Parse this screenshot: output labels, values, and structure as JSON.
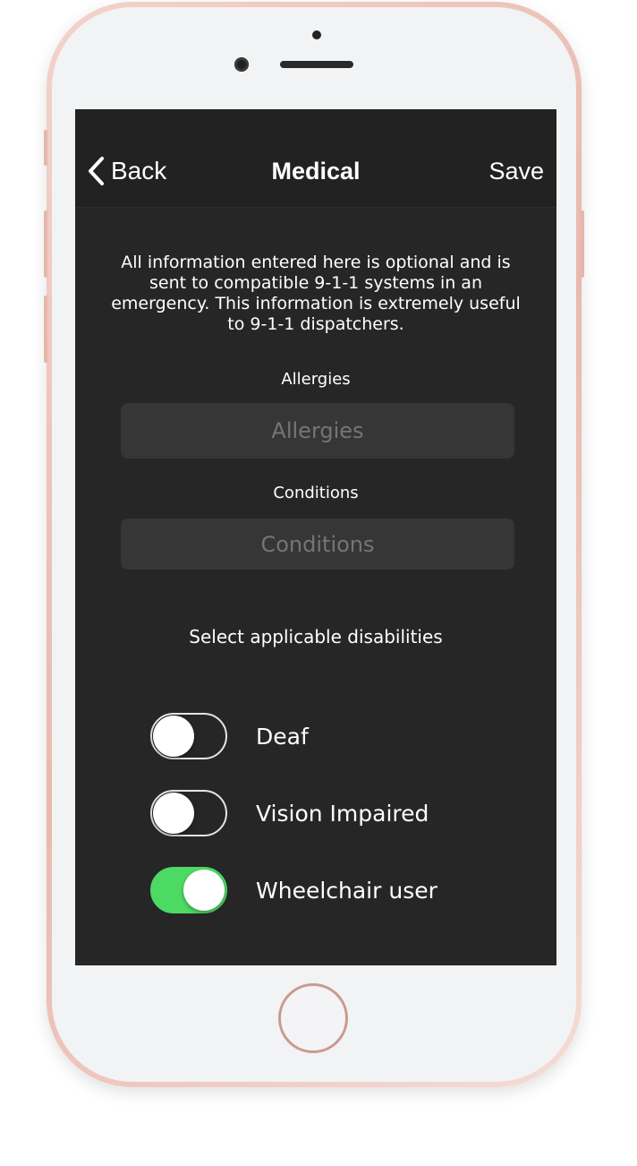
{
  "nav": {
    "back_label": "Back",
    "title": "Medical",
    "save_label": "Save"
  },
  "info_text": "All information entered here is optional and is sent to compatible 9-1-1 systems in an emergency. This information is extremely useful to 9-1-1 dispatchers.",
  "allergies": {
    "label": "Allergies",
    "placeholder": "Allergies",
    "value": ""
  },
  "conditions": {
    "label": "Conditions",
    "placeholder": "Conditions",
    "value": ""
  },
  "disabilities": {
    "heading": "Select applicable disabilities",
    "items": [
      {
        "label": "Deaf",
        "on": false
      },
      {
        "label": "Vision Impaired",
        "on": false
      },
      {
        "label": "Wheelchair user",
        "on": true
      }
    ]
  },
  "colors": {
    "toggle_on": "#4cd964",
    "background": "#262626",
    "nav_background": "#222222"
  }
}
